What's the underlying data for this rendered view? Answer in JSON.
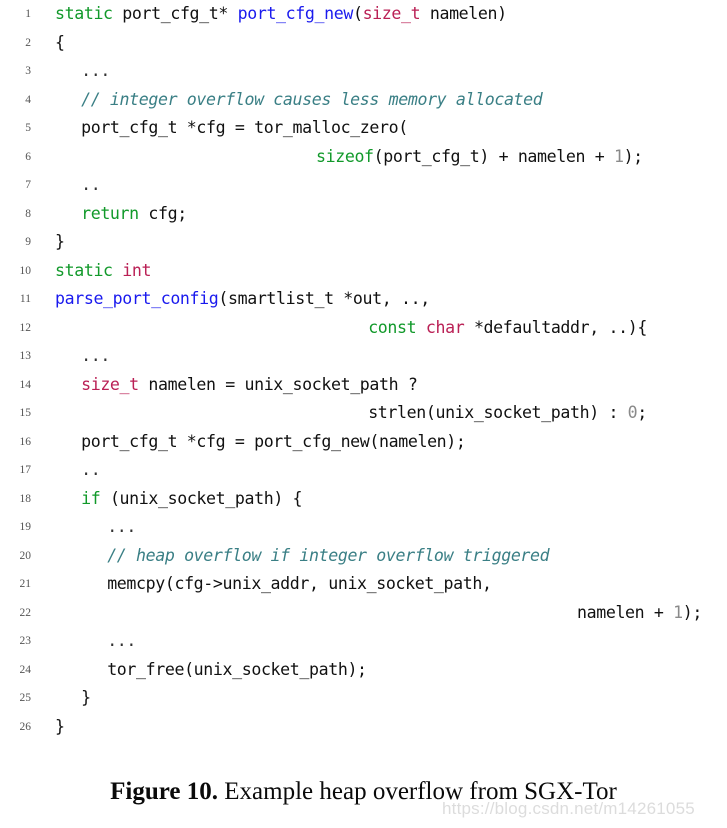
{
  "document": {
    "kind": "figure",
    "caption_label": "Figure 10.",
    "caption_text": " Example heap overflow from SGX-Tor",
    "watermark": "https://blog.csdn.net/m14261055"
  },
  "colors": {
    "background": "#ffffff",
    "text": "#111111",
    "keyword": "#11992a",
    "type": "#ba2055",
    "function": "#1a1aee",
    "comment": "#3a7f85",
    "number": "#8a8a8a",
    "line_number": "#555555",
    "watermark": "rgba(140,140,140,0.30)"
  },
  "code_listing": {
    "language": "c",
    "line_count": 26,
    "lines": [
      {
        "n": "1",
        "indent": 0,
        "tokens": [
          {
            "t": "static",
            "c": "kw"
          },
          {
            "t": " port_cfg_t* ",
            "c": ""
          },
          {
            "t": "port_cfg_new",
            "c": "fn"
          },
          {
            "t": "(",
            "c": ""
          },
          {
            "t": "size_t",
            "c": "type"
          },
          {
            "t": " namelen)",
            "c": ""
          }
        ]
      },
      {
        "n": "2",
        "indent": 0,
        "tokens": [
          {
            "t": "{",
            "c": ""
          }
        ]
      },
      {
        "n": "3",
        "indent": 2,
        "tokens": [
          {
            "t": "...",
            "c": "dots"
          }
        ]
      },
      {
        "n": "4",
        "indent": 2,
        "tokens": [
          {
            "t": "// integer overflow causes less memory allocated",
            "c": "cmt"
          }
        ]
      },
      {
        "n": "5",
        "indent": 2,
        "tokens": [
          {
            "t": "port_cfg_t *cfg = tor_malloc_zero(",
            "c": ""
          }
        ]
      },
      {
        "n": "6",
        "indent": 20,
        "tokens": [
          {
            "t": "sizeof",
            "c": "kw"
          },
          {
            "t": "(port_cfg_t) + namelen + ",
            "c": ""
          },
          {
            "t": "1",
            "c": "num"
          },
          {
            "t": ");",
            "c": ""
          }
        ]
      },
      {
        "n": "7",
        "indent": 2,
        "tokens": [
          {
            "t": "..",
            "c": "dots"
          }
        ]
      },
      {
        "n": "8",
        "indent": 2,
        "tokens": [
          {
            "t": "return",
            "c": "kw"
          },
          {
            "t": " cfg;",
            "c": ""
          }
        ]
      },
      {
        "n": "9",
        "indent": 0,
        "tokens": [
          {
            "t": "}",
            "c": ""
          }
        ]
      },
      {
        "n": "10",
        "indent": 0,
        "tokens": [
          {
            "t": "static",
            "c": "kw"
          },
          {
            "t": " ",
            "c": ""
          },
          {
            "t": "int",
            "c": "type"
          }
        ]
      },
      {
        "n": "11",
        "indent": 0,
        "tokens": [
          {
            "t": "parse_port_config",
            "c": "fn"
          },
          {
            "t": "(smartlist_t *out, ..,",
            "c": ""
          }
        ]
      },
      {
        "n": "12",
        "indent": 24,
        "tokens": [
          {
            "t": "const",
            "c": "kw"
          },
          {
            "t": " ",
            "c": ""
          },
          {
            "t": "char",
            "c": "type"
          },
          {
            "t": " *defaultaddr, ..){",
            "c": ""
          }
        ]
      },
      {
        "n": "13",
        "indent": 2,
        "tokens": [
          {
            "t": "...",
            "c": "dots"
          }
        ]
      },
      {
        "n": "14",
        "indent": 2,
        "tokens": [
          {
            "t": "size_t",
            "c": "type"
          },
          {
            "t": " namelen = unix_socket_path ?",
            "c": ""
          }
        ]
      },
      {
        "n": "15",
        "indent": 24,
        "tokens": [
          {
            "t": "strlen(unix_socket_path) : ",
            "c": ""
          },
          {
            "t": "0",
            "c": "num"
          },
          {
            "t": ";",
            "c": ""
          }
        ]
      },
      {
        "n": "16",
        "indent": 2,
        "tokens": [
          {
            "t": "port_cfg_t *cfg = port_cfg_new(namelen);",
            "c": ""
          }
        ]
      },
      {
        "n": "17",
        "indent": 2,
        "tokens": [
          {
            "t": "..",
            "c": "dots"
          }
        ]
      },
      {
        "n": "18",
        "indent": 2,
        "tokens": [
          {
            "t": "if",
            "c": "kw"
          },
          {
            "t": " (unix_socket_path) {",
            "c": ""
          }
        ]
      },
      {
        "n": "19",
        "indent": 4,
        "tokens": [
          {
            "t": "...",
            "c": "dots"
          }
        ]
      },
      {
        "n": "20",
        "indent": 4,
        "tokens": [
          {
            "t": "// heap overflow if integer overflow triggered",
            "c": "cmt"
          }
        ]
      },
      {
        "n": "21",
        "indent": 4,
        "tokens": [
          {
            "t": "memcpy(cfg->unix_addr, unix_socket_path,",
            "c": ""
          }
        ]
      },
      {
        "n": "22",
        "indent": 40,
        "tokens": [
          {
            "t": "namelen + ",
            "c": ""
          },
          {
            "t": "1",
            "c": "num"
          },
          {
            "t": ");",
            "c": ""
          }
        ]
      },
      {
        "n": "23",
        "indent": 4,
        "tokens": [
          {
            "t": "...",
            "c": "dots"
          }
        ]
      },
      {
        "n": "24",
        "indent": 4,
        "tokens": [
          {
            "t": "tor_free(unix_socket_path);",
            "c": ""
          }
        ]
      },
      {
        "n": "25",
        "indent": 2,
        "tokens": [
          {
            "t": "}",
            "c": ""
          }
        ]
      },
      {
        "n": "26",
        "indent": 0,
        "tokens": [
          {
            "t": "}",
            "c": ""
          }
        ]
      }
    ]
  }
}
